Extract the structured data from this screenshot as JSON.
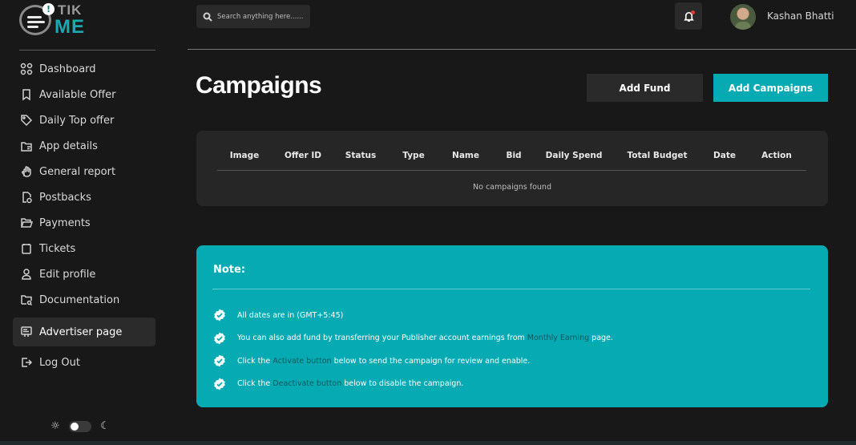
{
  "brand": {
    "line1": "TIK",
    "line2": "ME",
    "badge": "!"
  },
  "sidebar": {
    "items": [
      {
        "label": "Dashboard",
        "icon": "grid-icon"
      },
      {
        "label": "Available Offer",
        "icon": "bookmark-icon"
      },
      {
        "label": "Daily Top offer",
        "icon": "tag-icon"
      },
      {
        "label": "App details",
        "icon": "folder-doc-icon"
      },
      {
        "label": "General report",
        "icon": "hand-icon"
      },
      {
        "label": "Postbacks",
        "icon": "doc-refresh-icon"
      },
      {
        "label": "Payments",
        "icon": "folder-open-icon"
      },
      {
        "label": "Tickets",
        "icon": "ticket-icon"
      },
      {
        "label": "Edit profile",
        "icon": "user-icon"
      },
      {
        "label": "Documentation",
        "icon": "folder-search-icon"
      }
    ],
    "active_item": {
      "label": "Advertiser page",
      "icon": "billboard-icon"
    },
    "logout": {
      "label": "Log Out",
      "icon": "logout-icon"
    },
    "theme": {
      "sun": "☼",
      "moon": "☾"
    }
  },
  "header": {
    "search_placeholder": "Search anything here......",
    "user_name": "Kashan Bhatti"
  },
  "main": {
    "title": "Campaigns",
    "add_fund_label": "Add Fund",
    "add_campaign_label": "Add Campaigns",
    "table": {
      "columns": [
        "Image",
        "Offer ID",
        "Status",
        "Type",
        "Name",
        "Bid",
        "Daily Spend",
        "Total Budget",
        "Date",
        "Action"
      ],
      "empty_text": "No campaigns found"
    },
    "note": {
      "title": "Note:",
      "items": [
        {
          "before": "All dates are in (GMT+5:45)",
          "link": "",
          "after": ""
        },
        {
          "before": "You can also add fund by transferring your Publisher account earnings from ",
          "link": "Monthly Earning",
          "after": " page."
        },
        {
          "before": "Click the ",
          "link": "Activate button",
          "after": " below to send the campaign for review and enable."
        },
        {
          "before": "Click the ",
          "link": "Deactivate button",
          "after": " below to disable the campaign."
        }
      ]
    }
  },
  "colors": {
    "accent": "#05aab2",
    "background": "#181818",
    "card": "#262626",
    "notification_dot": "#e53935"
  }
}
